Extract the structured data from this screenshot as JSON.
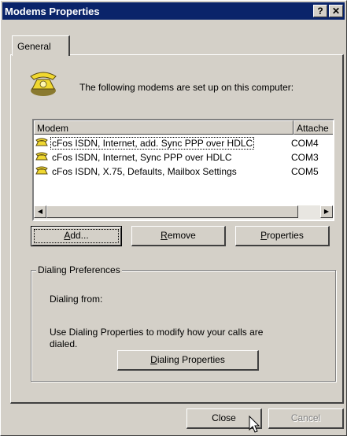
{
  "window": {
    "title": "Modems Properties",
    "help_glyph": "?",
    "close_glyph": "✕"
  },
  "tabs": [
    {
      "label": "General"
    }
  ],
  "intro_text": "The following modems are set up on this computer:",
  "modem_list": {
    "columns": [
      "Modem",
      "Attache"
    ],
    "rows": [
      {
        "name": "cFos ISDN, Internet, add. Sync PPP over HDLC",
        "port": "COM4",
        "selected": true
      },
      {
        "name": "cFos ISDN, Internet, Sync PPP over HDLC",
        "port": "COM3",
        "selected": false
      },
      {
        "name": "cFos ISDN, X.75, Defaults, Mailbox Settings",
        "port": "COM5",
        "selected": false
      }
    ],
    "scroll_left": "◀",
    "scroll_right": "▶"
  },
  "buttons": {
    "add": {
      "pre": "",
      "mnemonic": "A",
      "post": "dd..."
    },
    "remove": {
      "pre": "",
      "mnemonic": "R",
      "post": "emove"
    },
    "properties": {
      "pre": "",
      "mnemonic": "P",
      "post": "roperties"
    },
    "dialing_properties": {
      "pre": "",
      "mnemonic": "D",
      "post": "ialing Properties"
    },
    "close": "Close",
    "cancel": "Cancel"
  },
  "dialing_preferences": {
    "legend": "Dialing Preferences",
    "dialing_from": "Dialing from:",
    "note": "Use Dialing Properties to modify how your calls are dialed."
  },
  "icons": {
    "header": "telephone-icon",
    "row": "modem-icon",
    "cursor": "mouse-pointer-icon"
  },
  "colors": {
    "title_bar": "#0a246a",
    "face": "#d4d0c8"
  }
}
